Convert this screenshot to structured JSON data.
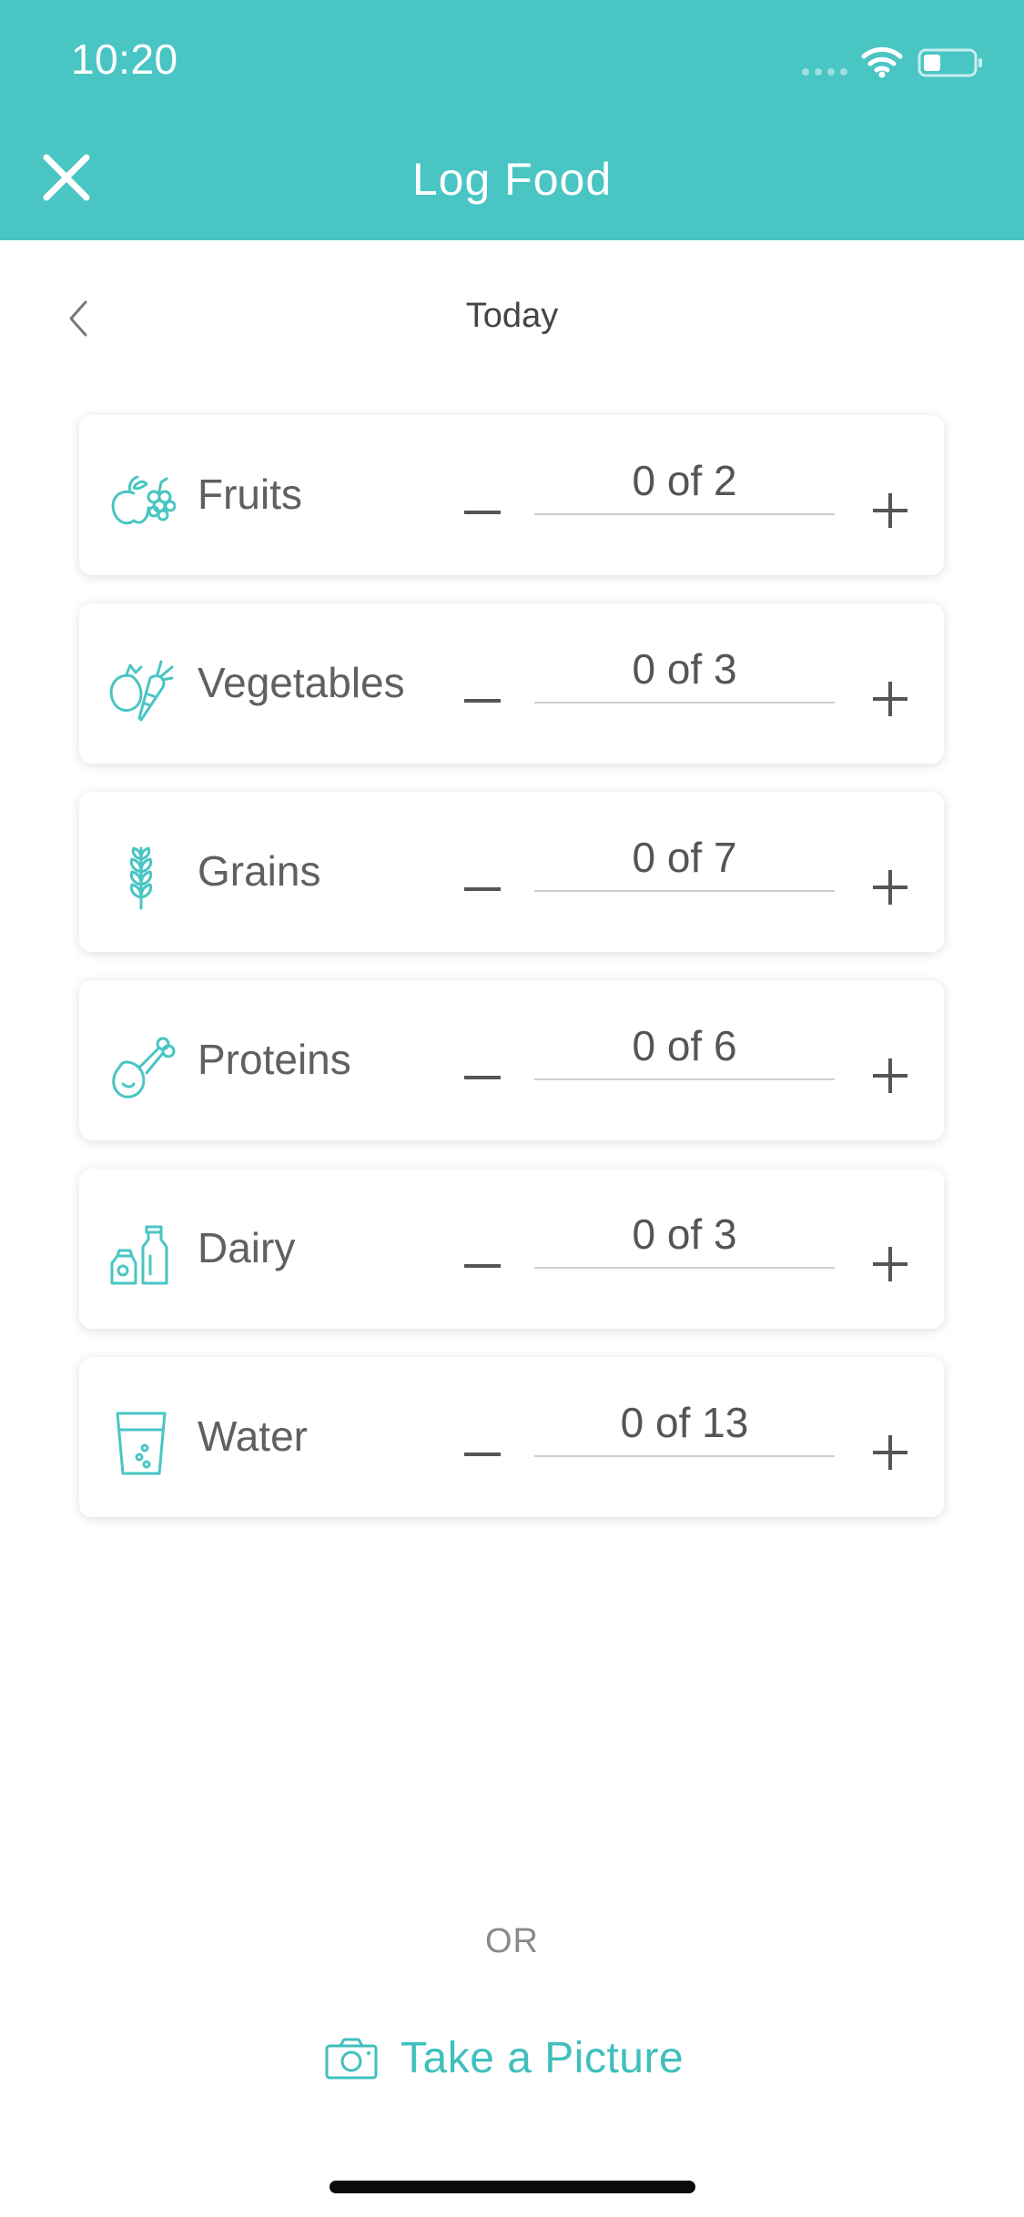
{
  "status_bar": {
    "time": "10:20"
  },
  "header": {
    "title": "Log Food",
    "close_icon": "close-icon",
    "background_color": "#49c5c3"
  },
  "date_nav": {
    "label": "Today",
    "back_icon": "chevron-left-icon"
  },
  "food_groups": [
    {
      "label": "Fruits",
      "icon": "fruits-icon",
      "count": "0 of 2",
      "logged": 0,
      "goal": 2
    },
    {
      "label": "Vegetables",
      "icon": "vegetables-icon",
      "count": "0 of 3",
      "logged": 0,
      "goal": 3
    },
    {
      "label": "Grains",
      "icon": "grains-icon",
      "count": "0 of 7",
      "logged": 0,
      "goal": 7
    },
    {
      "label": "Proteins",
      "icon": "proteins-icon",
      "count": "0 of 6",
      "logged": 0,
      "goal": 6
    },
    {
      "label": "Dairy",
      "icon": "dairy-icon",
      "count": "0 of 3",
      "logged": 0,
      "goal": 3
    },
    {
      "label": "Water",
      "icon": "water-icon",
      "count": "0 of 13",
      "logged": 0,
      "goal": 13
    }
  ],
  "divider_text": "OR",
  "take_picture": {
    "label": "Take a Picture",
    "icon": "camera-icon",
    "color": "#3fc0bd"
  },
  "accent_color": "#49c5c3"
}
